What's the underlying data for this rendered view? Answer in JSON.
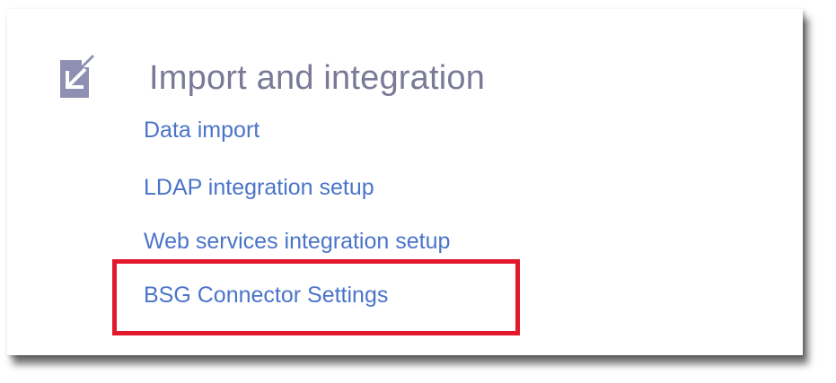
{
  "section": {
    "icon": "import-arrow-icon",
    "title": "Import and integration",
    "links": [
      {
        "label": "Data import"
      },
      {
        "label": "LDAP integration setup"
      },
      {
        "label": "Web services integration setup"
      },
      {
        "label": "BSG Connector Settings"
      }
    ]
  },
  "colors": {
    "title": "#7a7a96",
    "link": "#4a74c9",
    "icon": "#8f8fb3",
    "highlight": "#e3182d"
  }
}
